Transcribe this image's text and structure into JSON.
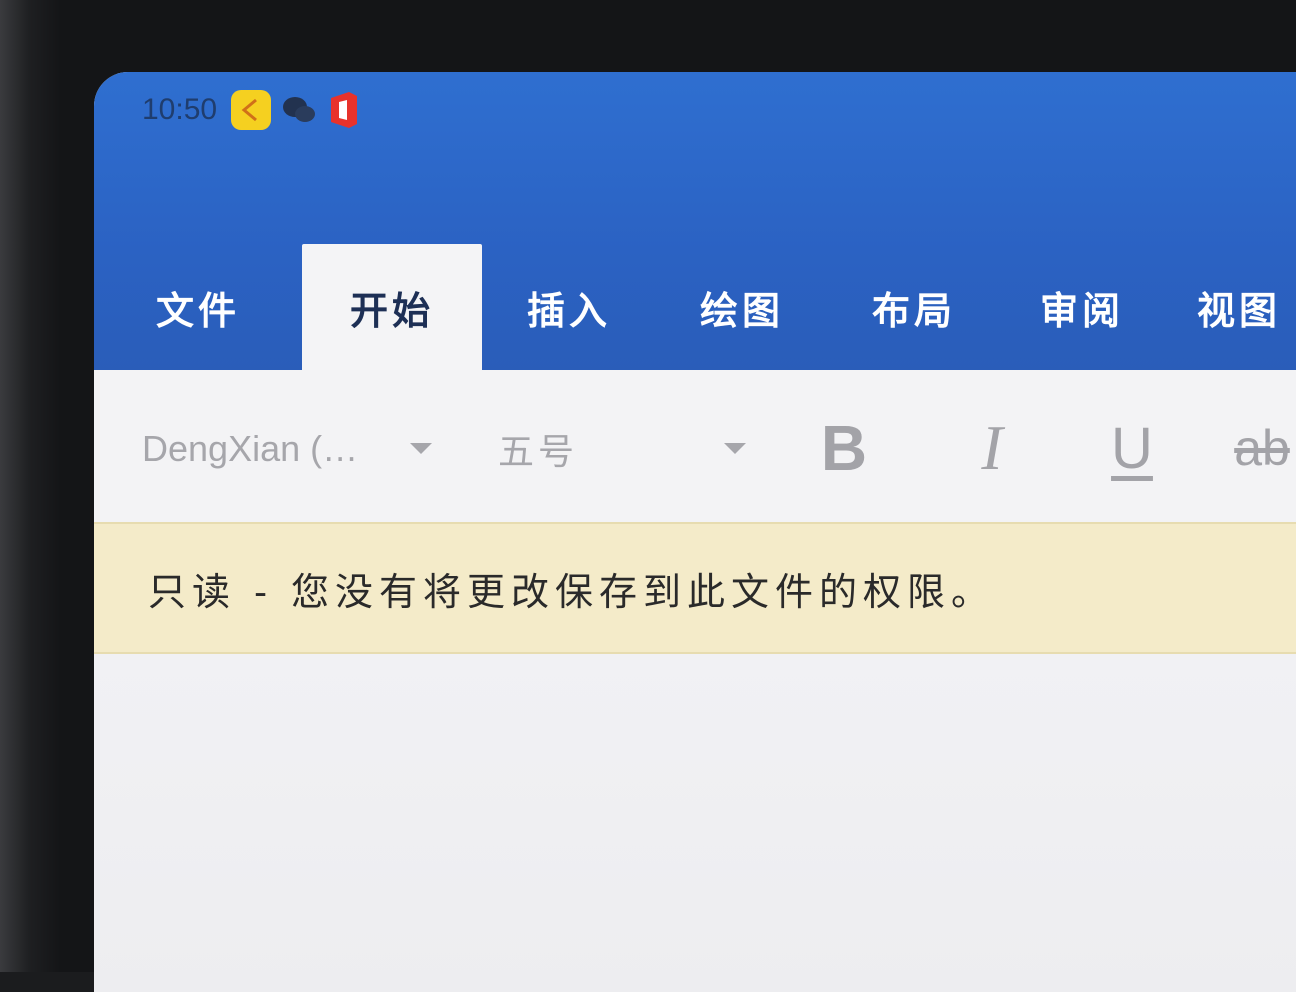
{
  "status_bar": {
    "time": "10:50",
    "icons": [
      "yellow-app-icon",
      "wechat-icon",
      "office-icon"
    ]
  },
  "ribbon_tabs": [
    {
      "label": "文件",
      "active": false
    },
    {
      "label": "开始",
      "active": true
    },
    {
      "label": "插入",
      "active": false
    },
    {
      "label": "绘图",
      "active": false
    },
    {
      "label": "布局",
      "active": false
    },
    {
      "label": "审阅",
      "active": false
    },
    {
      "label": "视图",
      "active": false
    }
  ],
  "toolbar": {
    "font_name": "DengXian (…",
    "font_size": "五号",
    "bold_label": "B",
    "italic_label": "I",
    "underline_label": "U",
    "strikethrough_label": "ab"
  },
  "info_bar": {
    "message": "只读 - 您没有将更改保存到此文件的权限。"
  },
  "colors": {
    "title_bar": "#2b62c3",
    "info_bar": "#f4ebc9",
    "ribbon": "#f3f3f5"
  }
}
